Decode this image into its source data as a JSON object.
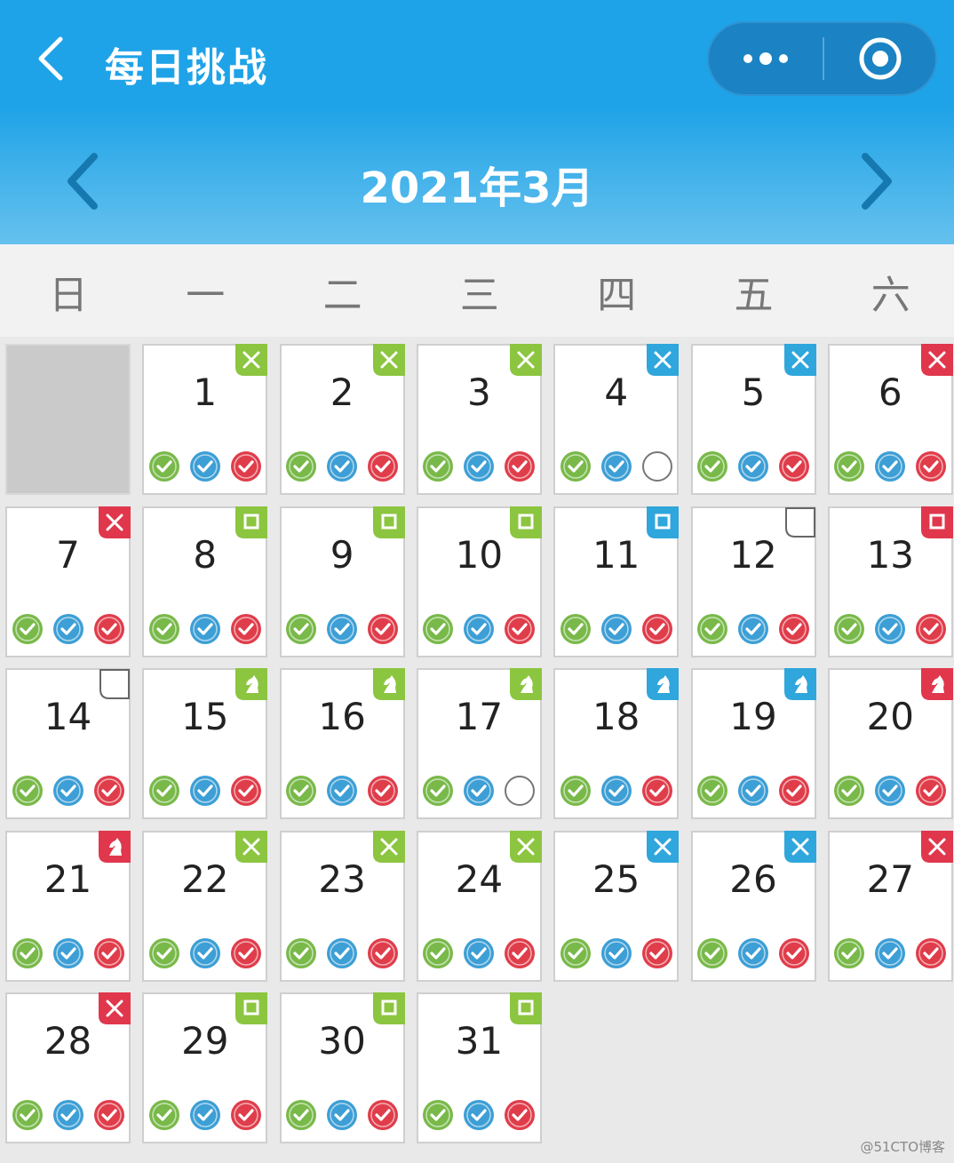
{
  "navbar": {
    "title": "每日挑战",
    "back_icon": "chevron-left-icon",
    "more_icon": "more-dots-icon",
    "close_icon": "target-circle-icon"
  },
  "calendar": {
    "month_label": "2021年3月",
    "weekdays": [
      "日",
      "一",
      "二",
      "三",
      "四",
      "五",
      "六"
    ],
    "leading_empty": 1,
    "colors": {
      "green": "#8cc540",
      "blue": "#2fa6dc",
      "red": "#e0374d",
      "check_green": "#79b94a",
      "check_blue": "#3d9fd5",
      "check_red": "#e03d4b"
    },
    "days": [
      {
        "day": "1",
        "badge": "cross",
        "badge_color": "green",
        "checks": [
          "done",
          "done",
          "done"
        ]
      },
      {
        "day": "2",
        "badge": "cross",
        "badge_color": "green",
        "checks": [
          "done",
          "done",
          "done"
        ]
      },
      {
        "day": "3",
        "badge": "cross",
        "badge_color": "green",
        "checks": [
          "done",
          "done",
          "done"
        ]
      },
      {
        "day": "4",
        "badge": "cross",
        "badge_color": "blue",
        "checks": [
          "done",
          "done",
          "empty"
        ]
      },
      {
        "day": "5",
        "badge": "cross",
        "badge_color": "blue",
        "checks": [
          "done",
          "done",
          "done"
        ]
      },
      {
        "day": "6",
        "badge": "cross",
        "badge_color": "red",
        "checks": [
          "done",
          "done",
          "done"
        ]
      },
      {
        "day": "7",
        "badge": "cross",
        "badge_color": "red",
        "checks": [
          "done",
          "done",
          "done"
        ]
      },
      {
        "day": "8",
        "badge": "square",
        "badge_color": "green",
        "checks": [
          "done",
          "done",
          "done"
        ]
      },
      {
        "day": "9",
        "badge": "square",
        "badge_color": "green",
        "checks": [
          "done",
          "done",
          "done"
        ]
      },
      {
        "day": "10",
        "badge": "square",
        "badge_color": "green",
        "checks": [
          "done",
          "done",
          "done"
        ]
      },
      {
        "day": "11",
        "badge": "square",
        "badge_color": "blue",
        "checks": [
          "done",
          "done",
          "done"
        ]
      },
      {
        "day": "12",
        "badge": "outline",
        "badge_color": "none",
        "checks": [
          "done",
          "done",
          "done"
        ]
      },
      {
        "day": "13",
        "badge": "square",
        "badge_color": "red",
        "checks": [
          "done",
          "done",
          "done"
        ]
      },
      {
        "day": "14",
        "badge": "outline",
        "badge_color": "none",
        "checks": [
          "done",
          "done",
          "done"
        ]
      },
      {
        "day": "15",
        "badge": "knight",
        "badge_color": "green",
        "checks": [
          "done",
          "done",
          "done"
        ]
      },
      {
        "day": "16",
        "badge": "knight",
        "badge_color": "green",
        "checks": [
          "done",
          "done",
          "done"
        ]
      },
      {
        "day": "17",
        "badge": "knight",
        "badge_color": "green",
        "checks": [
          "done",
          "done",
          "empty"
        ]
      },
      {
        "day": "18",
        "badge": "knight",
        "badge_color": "blue",
        "checks": [
          "done",
          "done",
          "done"
        ]
      },
      {
        "day": "19",
        "badge": "knight",
        "badge_color": "blue",
        "checks": [
          "done",
          "done",
          "done"
        ]
      },
      {
        "day": "20",
        "badge": "knight",
        "badge_color": "red",
        "checks": [
          "done",
          "done",
          "done"
        ]
      },
      {
        "day": "21",
        "badge": "knight",
        "badge_color": "red",
        "checks": [
          "done",
          "done",
          "done"
        ]
      },
      {
        "day": "22",
        "badge": "cross",
        "badge_color": "green",
        "checks": [
          "done",
          "done",
          "done"
        ]
      },
      {
        "day": "23",
        "badge": "cross",
        "badge_color": "green",
        "checks": [
          "done",
          "done",
          "done"
        ]
      },
      {
        "day": "24",
        "badge": "cross",
        "badge_color": "green",
        "checks": [
          "done",
          "done",
          "done"
        ]
      },
      {
        "day": "25",
        "badge": "cross",
        "badge_color": "blue",
        "checks": [
          "done",
          "done",
          "done"
        ]
      },
      {
        "day": "26",
        "badge": "cross",
        "badge_color": "blue",
        "checks": [
          "done",
          "done",
          "done"
        ]
      },
      {
        "day": "27",
        "badge": "cross",
        "badge_color": "red",
        "checks": [
          "done",
          "done",
          "done"
        ]
      },
      {
        "day": "28",
        "badge": "cross",
        "badge_color": "red",
        "checks": [
          "done",
          "done",
          "done"
        ]
      },
      {
        "day": "29",
        "badge": "square",
        "badge_color": "green",
        "checks": [
          "done",
          "done",
          "done"
        ]
      },
      {
        "day": "30",
        "badge": "square",
        "badge_color": "green",
        "checks": [
          "done",
          "done",
          "done"
        ]
      },
      {
        "day": "31",
        "badge": "square",
        "badge_color": "green",
        "checks": [
          "done",
          "done",
          "done"
        ]
      }
    ]
  },
  "watermark": "@51CTO博客"
}
